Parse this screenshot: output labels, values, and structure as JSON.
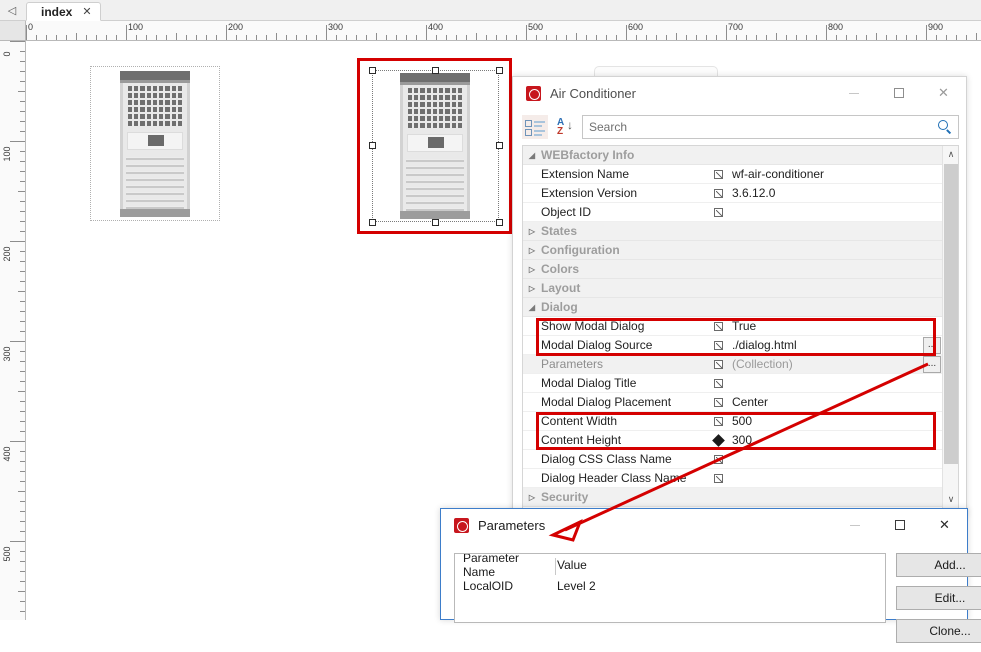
{
  "tabstrip": {
    "back_icon": "◁",
    "tabs": [
      {
        "label": "index",
        "close": "✕"
      }
    ]
  },
  "rulers": {
    "horizontal_labels": [
      "0",
      "100",
      "200",
      "300",
      "400",
      "500",
      "600",
      "700",
      "800",
      "900"
    ],
    "vertical_labels": [
      "0",
      "100",
      "200",
      "300",
      "400",
      "500"
    ],
    "unit_step": 100
  },
  "canvas": {
    "objects": [
      {
        "name": "air-conditioner-unlselected",
        "selected": false
      },
      {
        "name": "air-conditioner-selected",
        "selected": true
      }
    ]
  },
  "property_window": {
    "title": "Air Conditioner",
    "icon": "wf-logo-icon",
    "window_buttons": {
      "minimize": "—",
      "maximize": "☐",
      "close": "✕"
    },
    "toolbar": {
      "categorized_icon": "categorized-view-icon",
      "alphabetical_icon": "alphabetical-sort-icon",
      "sort_a": "A",
      "sort_z": "Z",
      "sort_arrow": "↓"
    },
    "search": {
      "placeholder": "Search",
      "value": "",
      "icon": "search-icon"
    },
    "scrollbar": {
      "up": "∧",
      "down": "∨"
    },
    "ellipsis_label": "...",
    "groups": [
      {
        "label": "WEBfactory Info",
        "expanded": true,
        "arrow": "◢",
        "rows": [
          {
            "name": "Extension Name",
            "glyph": "bind",
            "value": "wf-air-conditioner",
            "dim": false,
            "ellipsis": false
          },
          {
            "name": "Extension Version",
            "glyph": "bind",
            "value": "3.6.12.0",
            "dim": false,
            "ellipsis": false
          },
          {
            "name": "Object ID",
            "glyph": "bind",
            "value": "",
            "dim": false,
            "ellipsis": false
          }
        ]
      },
      {
        "label": "States",
        "expanded": false,
        "arrow": "▷",
        "rows": []
      },
      {
        "label": "Configuration",
        "expanded": false,
        "arrow": "▷",
        "rows": []
      },
      {
        "label": "Colors",
        "expanded": false,
        "arrow": "▷",
        "rows": []
      },
      {
        "label": "Layout",
        "expanded": false,
        "arrow": "▷",
        "rows": []
      },
      {
        "label": "Dialog",
        "expanded": true,
        "arrow": "◢",
        "rows": [
          {
            "name": "Show Modal Dialog",
            "glyph": "bind",
            "value": "True",
            "dim": false,
            "ellipsis": false
          },
          {
            "name": "Modal Dialog Source",
            "glyph": "bind",
            "value": "./dialog.html",
            "dim": false,
            "ellipsis": true
          },
          {
            "name": "Parameters",
            "glyph": "bind",
            "value": "(Collection)",
            "dim": true,
            "ellipsis": true
          },
          {
            "name": "Modal Dialog Title",
            "glyph": "bind",
            "value": "",
            "dim": false,
            "ellipsis": false
          },
          {
            "name": "Modal Dialog Placement",
            "glyph": "bind",
            "value": "Center",
            "dim": false,
            "ellipsis": false
          },
          {
            "name": "Content Width",
            "glyph": "bind",
            "value": "500",
            "dim": false,
            "ellipsis": false
          },
          {
            "name": "Content Height",
            "glyph": "diamond",
            "value": "300",
            "dim": false,
            "ellipsis": false
          },
          {
            "name": "Dialog CSS Class Name",
            "glyph": "bind",
            "value": "",
            "dim": false,
            "ellipsis": false
          },
          {
            "name": "Dialog Header Class Name",
            "glyph": "bind",
            "value": "",
            "dim": false,
            "ellipsis": false
          }
        ]
      },
      {
        "label": "Security",
        "expanded": false,
        "arrow": "▷",
        "rows": []
      }
    ]
  },
  "parameters_window": {
    "title": "Parameters",
    "icon": "wf-logo-icon",
    "window_buttons": {
      "minimize": "—",
      "maximize": "☐",
      "close": "✕"
    },
    "table": {
      "headers": [
        "Parameter Name",
        "Value"
      ],
      "rows": [
        {
          "name": "LocalOID",
          "value": "Level 2"
        }
      ]
    },
    "buttons": [
      "Add...",
      "Edit...",
      "Clone..."
    ]
  },
  "annotations": {
    "accent_color": "#d40000",
    "boxes": [
      {
        "name": "highlight-show-modal-dialog-source"
      },
      {
        "name": "highlight-content-size"
      },
      {
        "name": "highlight-selected-object"
      }
    ],
    "arrow": {
      "name": "parameters-ellipsis-to-dialog-arrow"
    }
  }
}
